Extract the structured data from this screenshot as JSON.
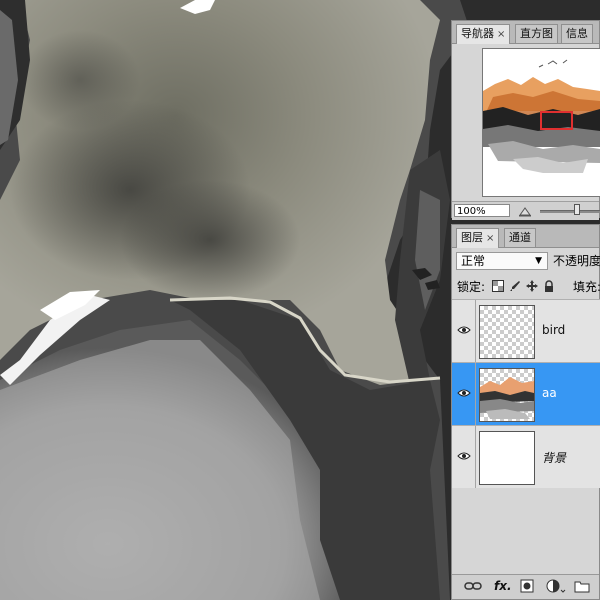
{
  "navigator_panel": {
    "tabs": [
      {
        "label": "导航器",
        "close": "×"
      },
      {
        "label": "直方图"
      },
      {
        "label": "信息"
      }
    ],
    "zoom": "100%"
  },
  "layers_panel": {
    "tabs": [
      {
        "label": "图层",
        "close": "×"
      },
      {
        "label": "通道"
      }
    ],
    "blend_mode": "正常",
    "opacity_label": "不透明度:",
    "lock_label": "锁定:",
    "fill_label": "填充:",
    "layers": [
      {
        "name": "bird",
        "selected": false
      },
      {
        "name": "aa",
        "selected": true
      },
      {
        "name": "背景",
        "selected": false
      }
    ],
    "footer": {
      "fx": "fx."
    }
  },
  "icons": [
    "link-icon",
    "fx-icon",
    "layer-mask-icon",
    "adjustment-layer-icon",
    "new-group-icon",
    "eye-icon",
    "lock-transparent-icon",
    "lock-brush-icon",
    "lock-move-icon",
    "lock-all-icon",
    "zoom-out-icon",
    "close-icon"
  ],
  "colors": {
    "selection": "#3797f3",
    "navigator_view_box": "#e03030"
  }
}
